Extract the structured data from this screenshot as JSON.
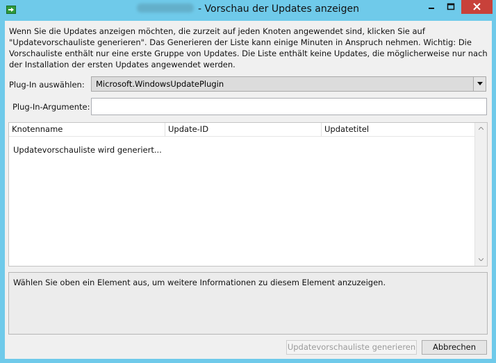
{
  "window": {
    "title": "- Vorschau der Updates anzeigen"
  },
  "description": "Wenn Sie die Updates anzeigen möchten, die zurzeit auf jeden Knoten angewendet sind, klicken Sie auf \"Updatevorschauliste generieren\". Das Generieren der Liste kann einige Minuten in Anspruch nehmen. Wichtig: Die Vorschauliste enthält nur eine erste Gruppe von Updates. Die Liste enthält keine Updates, die möglicherweise nur nach der Installation der ersten Updates angewendet werden.",
  "plugin": {
    "label": "Plug-In auswählen:",
    "value": "Microsoft.WindowsUpdatePlugin"
  },
  "args": {
    "label": "Plug-In-Argumente:",
    "value": ""
  },
  "list": {
    "columns": [
      "Knotenname",
      "Update-ID",
      "Updatetitel"
    ],
    "status": "Updatevorschauliste wird generiert..."
  },
  "detail": {
    "text": "Wählen Sie oben ein Element aus, um weitere Informationen zu diesem Element anzuzeigen."
  },
  "buttons": {
    "generate": "Updatevorschauliste generieren",
    "cancel": "Abbrechen"
  },
  "colors": {
    "titlebar": "#6fcaea",
    "close": "#c8413a"
  }
}
